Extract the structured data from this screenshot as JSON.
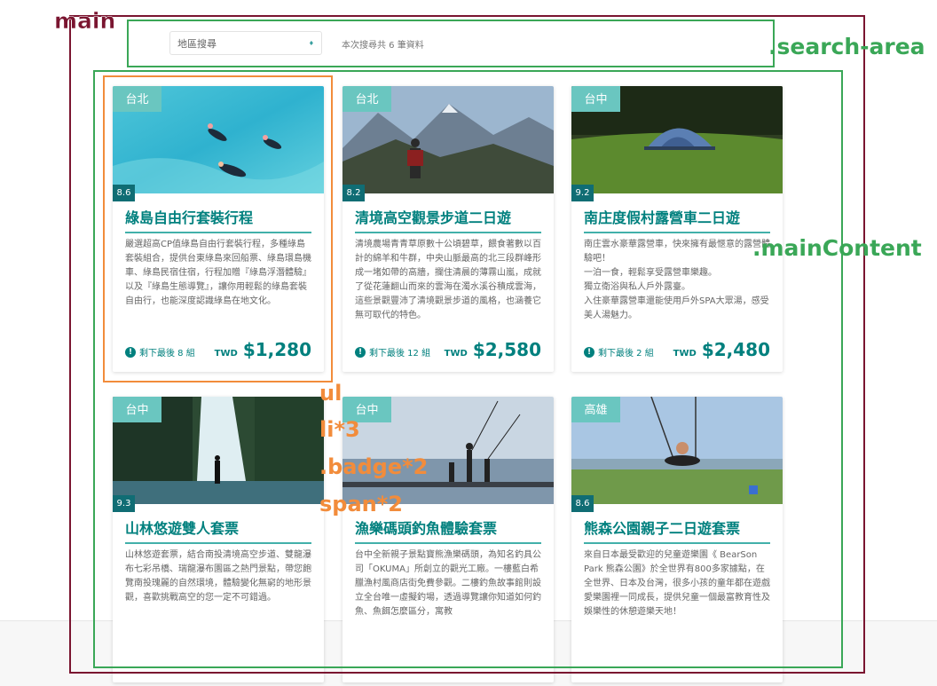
{
  "annotations": {
    "main": "main",
    "search_area": ".search-area",
    "main_content": ".mainContent",
    "ul": "ul",
    "li": "li*3",
    "badge": ".badge*2",
    "span": "span*2"
  },
  "search": {
    "select_label": "地區搜尋",
    "arrow": "♦",
    "result_text": "本次搜尋共 6 筆資料"
  },
  "colors": {
    "primary": "#00807e",
    "badge": "#6ac6c0",
    "score_bg": "#106d74",
    "annotation_main": "#7a1530",
    "annotation_green": "#3aa757",
    "annotation_orange": "#f28c3b"
  },
  "cards": [
    {
      "region": "台北",
      "score": "8.6",
      "title": "綠島自由行套裝行程",
      "description": "嚴選超高CP值綠島自由行套裝行程，多種綠島套裝組合，提供台東綠島來回船票、綠島環島機車、綠島民宿住宿，行程加贈『綠島浮潛體驗』以及『綠島生態導覽』，讓你用輕鬆的綠島套裝自由行，也能深度認識綠島在地文化。",
      "stock": "剩下最後 8 組",
      "currency": "TWD",
      "price": "$1,280",
      "image": "snorkeling-photo"
    },
    {
      "region": "台北",
      "score": "8.2",
      "title": "清境高空觀景步道二日遊",
      "description": "清境農場青青草原數十公頃碧草，餵食著數以百計的綿羊和牛群，中央山脈最高的北三段群峰形成一堵如帶的高牆，攔住清晨的薄霧山嵐，成就了從花蓮翻山而來的雲海在濁水溪谷積成雲海，這些景觀豐沛了清境觀景步道的風格，也涵養它無可取代的特色。",
      "stock": "剩下最後 12 組",
      "currency": "TWD",
      "price": "$2,580",
      "image": "mountain-hiker-photo"
    },
    {
      "region": "台中",
      "score": "9.2",
      "title": "南庄度假村露營車二日遊",
      "description": "南庄雲水豪華露營車，快來擁有最愜意的露營體驗吧！\n一泊一食，輕鬆享受露營車樂趣。\n獨立衛浴與私人戶外露臺。\n入住豪華露營車還能使用戶外SPA大眾湯，感受美人湯魅力。",
      "stock": "剩下最後 2 組",
      "currency": "TWD",
      "price": "$2,480",
      "image": "camping-tent-photo"
    },
    {
      "region": "台中",
      "score": "9.3",
      "title": "山林悠遊雙人套票",
      "description": "山林悠遊套票，結合南投清境高空步道、雙龍瀑布七彩吊橋、瑞龍瀑布園區之熱門景點，帶您飽覽南投瑰麗的自然環境，體驗變化無窮的地形景觀，喜歡挑戰高空的您一定不可錯過。",
      "stock": "",
      "currency": "",
      "price": "",
      "image": "waterfall-photo"
    },
    {
      "region": "台中",
      "score": "",
      "title": "漁樂碼頭釣魚體驗套票",
      "description": "台中全新親子景點寶熊漁樂碼頭，為知名釣具公司「OKUMA」所創立的觀光工廠。一樓藍白希臘漁村風商店街免費參觀。二樓釣魚故事館則設立全台唯一虛擬釣場，透過導覽讓你知道如何釣魚、魚餌怎麼區分，寓教",
      "stock": "",
      "currency": "",
      "price": "",
      "image": "fishing-pier-photo"
    },
    {
      "region": "高雄",
      "score": "8.6",
      "title": "熊森公園親子二日遊套票",
      "description": "來自日本最受歡迎的兒童遊樂園《 BearSon Park 熊森公園》於全世界有800多家據點，在全世界、日本及台灣，很多小孩的童年都在遊戲愛樂園裡一同成長，提供兒童一個最富教育性及娛樂性的休憩遊樂天地！",
      "stock": "",
      "currency": "",
      "price": "",
      "image": "park-swing-photo"
    }
  ]
}
